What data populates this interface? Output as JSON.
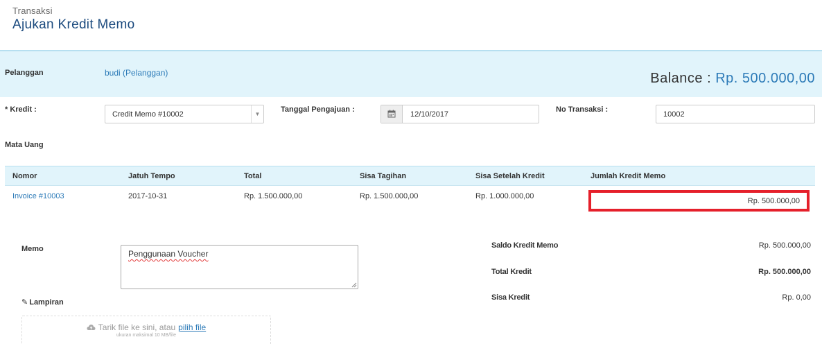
{
  "header": {
    "breadcrumb": "Transaksi",
    "title": "Ajukan Kredit Memo"
  },
  "customer": {
    "label": "Pelanggan",
    "value": "budi (Pelanggan)",
    "balance_label": "Balance :",
    "balance_amount": "Rp. 500.000,00"
  },
  "form": {
    "kredit_label": "* Kredit :",
    "kredit_value": "Credit Memo #10002",
    "tanggal_label": "Tanggal Pengajuan :",
    "tanggal_value": "12/10/2017",
    "no_transaksi_label": "No Transaksi :",
    "no_transaksi_value": "10002",
    "mata_uang_label": "Mata Uang"
  },
  "table": {
    "headers": [
      "Nomor",
      "Jatuh Tempo",
      "Total",
      "Sisa Tagihan",
      "Sisa Setelah Kredit",
      "Jumlah Kredit Memo"
    ],
    "rows": [
      {
        "nomor": "Invoice #10003",
        "jatuh_tempo": "2017-10-31",
        "total": "Rp. 1.500.000,00",
        "sisa_tagihan": "Rp. 1.500.000,00",
        "sisa_setelah_kredit": "Rp. 1.000.000,00",
        "jumlah_kredit_memo": "Rp. 500.000,00"
      }
    ]
  },
  "memo": {
    "label": "Memo",
    "value": "Penggunaan Voucher"
  },
  "attachment": {
    "label": "Lampiran",
    "drop_text": "Tarik file ke sini, atau",
    "pick_text": "pilih file",
    "hint": "ukuran maksimal 10 MB/file"
  },
  "summary": {
    "saldo_label": "Saldo Kredit Memo",
    "saldo_value": "Rp. 500.000,00",
    "total_label": "Total Kredit",
    "total_value": "Rp. 500.000,00",
    "sisa_label": "Sisa Kredit",
    "sisa_value": "Rp. 0,00"
  },
  "colors": {
    "accent": "#2d7bb8",
    "title": "#1b4a7e",
    "band": "#e1f4fb",
    "highlight": "#e5202b"
  }
}
